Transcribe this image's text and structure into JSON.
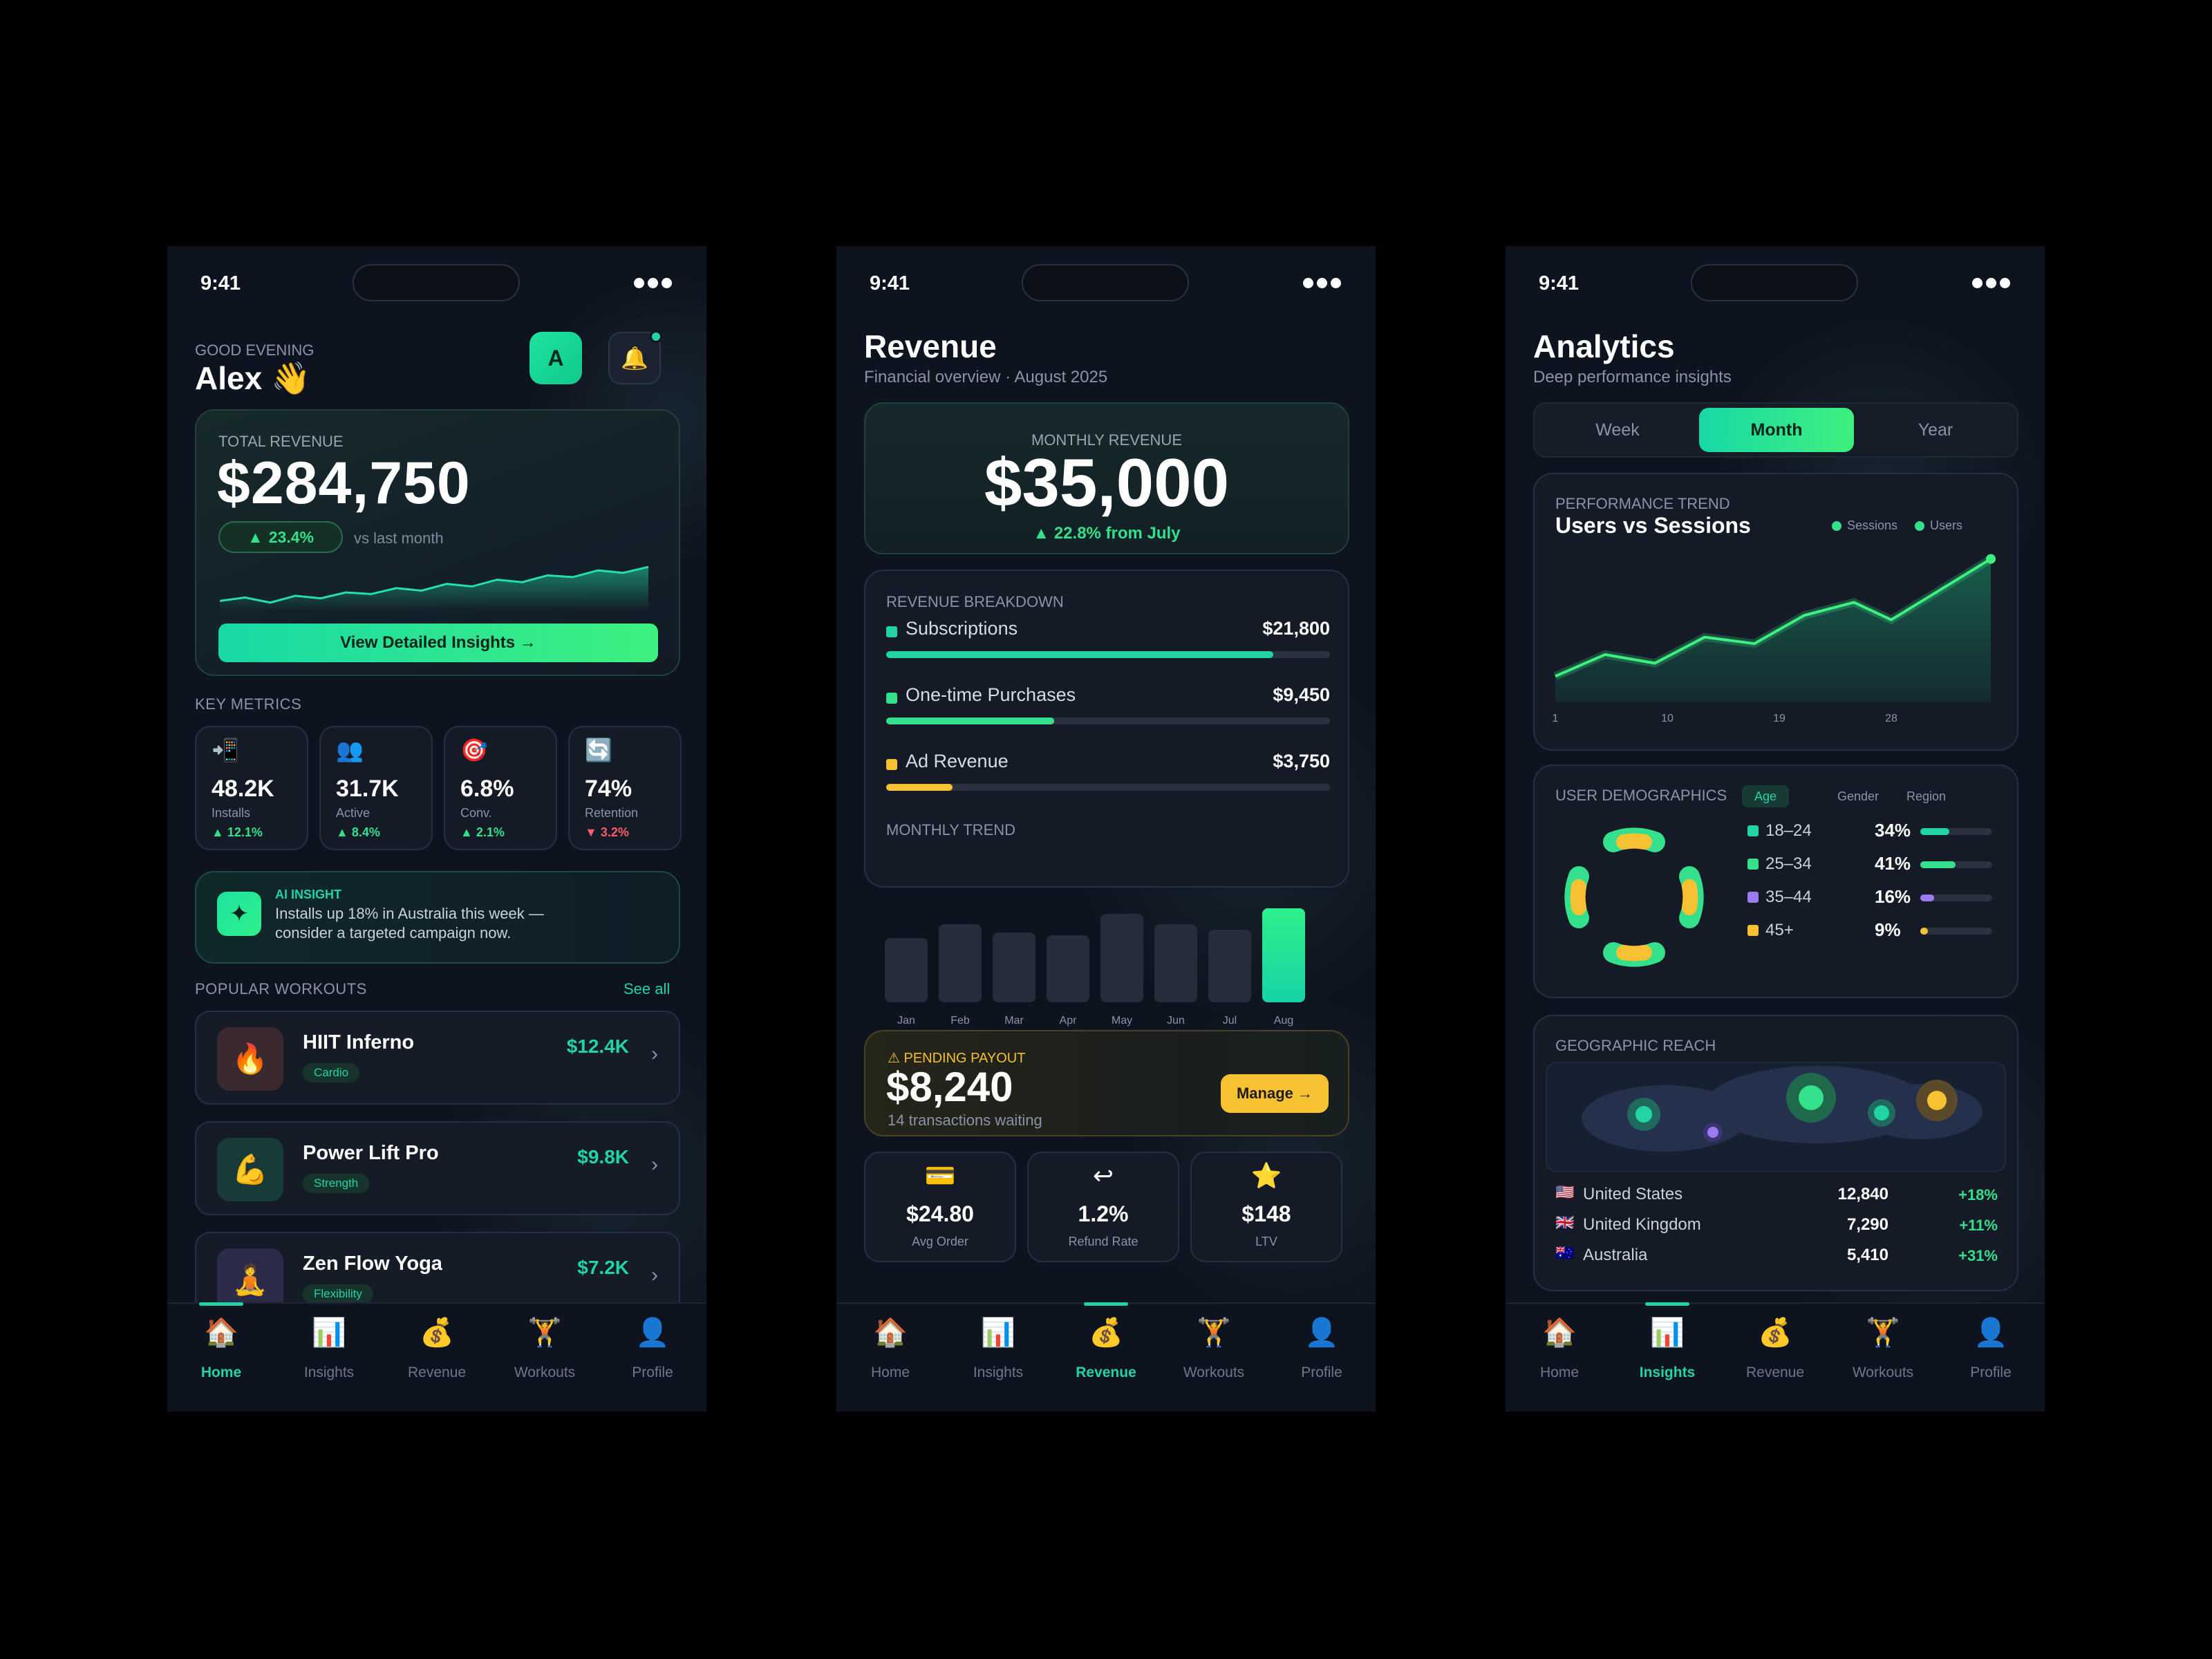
{
  "status": {
    "time": "9:41"
  },
  "colors": {
    "accent": "#22d3a6",
    "up": "#34e08b",
    "down": "#ff5c6a",
    "yellow": "#f6c233",
    "purple": "#9b7cf0"
  },
  "home": {
    "greeting": "GOOD EVENING",
    "name": "Alex 👋",
    "avatar": "A",
    "notification_icon": "bell-icon",
    "revenue": {
      "label": "TOTAL REVENUE",
      "value": "$284,750",
      "change": "23.4%",
      "compare": "vs last month",
      "button": "View Detailed Insights →",
      "sparkline": [
        30,
        34,
        28,
        36,
        33,
        40,
        38,
        45,
        42,
        50,
        47,
        55,
        52,
        60,
        58,
        66,
        63,
        70
      ]
    },
    "metrics_title": "KEY METRICS",
    "metrics": [
      {
        "icon": "📲",
        "value": "48.2K",
        "label": "Installs",
        "delta": "▲ 12.1%",
        "dir": "up"
      },
      {
        "icon": "👥",
        "value": "31.7K",
        "label": "Active",
        "delta": "▲ 8.4%",
        "dir": "up"
      },
      {
        "icon": "🎯",
        "value": "6.8%",
        "label": "Conv.",
        "delta": "▲ 2.1%",
        "dir": "up"
      },
      {
        "icon": "🔄",
        "value": "74%",
        "label": "Retention",
        "delta": "▼ 3.2%",
        "dir": "down"
      }
    ],
    "ai": {
      "icon": "✦",
      "title": "AI INSIGHT",
      "body": "Installs up 18% in Australia this week — consider a targeted campaign now."
    },
    "workouts_title": "POPULAR WORKOUTS",
    "see_all": "See all",
    "workouts": [
      {
        "icon": "🔥",
        "name": "HIIT Inferno",
        "tag": "Cardio",
        "price": "$12.4K",
        "bg": "#3a2a30"
      },
      {
        "icon": "💪",
        "name": "Power Lift Pro",
        "tag": "Strength",
        "price": "$9.8K",
        "bg": "#183a38"
      },
      {
        "icon": "🧘",
        "name": "Zen Flow Yoga",
        "tag": "Flexibility",
        "price": "$7.2K",
        "bg": "#2c2c4a"
      }
    ]
  },
  "tabs": [
    {
      "icon": "🏠",
      "label": "Home"
    },
    {
      "icon": "📊",
      "label": "Insights"
    },
    {
      "icon": "💰",
      "label": "Revenue"
    },
    {
      "icon": "🏋",
      "label": "Workouts"
    },
    {
      "icon": "👤",
      "label": "Profile"
    }
  ],
  "revenue": {
    "title": "Revenue",
    "subtitle": "Financial overview · August 2025",
    "monthly": {
      "label": "MONTHLY REVENUE",
      "value": "$35,000",
      "change": "▲ 22.8% from July"
    },
    "breakdown_title": "REVENUE BREAKDOWN",
    "breakdown": [
      {
        "name": "Subscriptions",
        "value": "$21,800",
        "amount": 21800,
        "color": "#22d3a6"
      },
      {
        "name": "One-time Purchases",
        "value": "$9,450",
        "amount": 9450,
        "color": "#34e08b"
      },
      {
        "name": "Ad Revenue",
        "value": "$3,750",
        "amount": 3750,
        "color": "#f6c233"
      }
    ],
    "trend_title": "MONTHLY TREND",
    "trend": {
      "months": [
        "Jan",
        "Feb",
        "Mar",
        "Apr",
        "May",
        "Jun",
        "Jul",
        "Aug"
      ],
      "values": [
        24,
        29,
        26,
        25,
        33,
        29,
        27,
        35
      ],
      "highlight": 7
    },
    "payout": {
      "label": "⚠ PENDING PAYOUT",
      "value": "$8,240",
      "sub": "14 transactions waiting",
      "button": "Manage →"
    },
    "stats": [
      {
        "icon": "💳",
        "value": "$24.80",
        "label": "Avg Order"
      },
      {
        "icon": "↩",
        "value": "1.2%",
        "label": "Refund Rate"
      },
      {
        "icon": "⭐",
        "value": "$148",
        "label": "LTV"
      }
    ]
  },
  "analytics": {
    "title": "Analytics",
    "subtitle": "Deep performance insights",
    "periods": [
      "Week",
      "Month",
      "Year"
    ],
    "active_period": 1,
    "performance": {
      "label": "PERFORMANCE TREND",
      "title": "Users vs Sessions",
      "legend": [
        "Sessions",
        "Users"
      ]
    },
    "demographics": {
      "label": "USER DEMOGRAPHICS",
      "tabs": [
        "Age",
        "Gender",
        "Region"
      ],
      "rows": [
        {
          "name": "18–24",
          "value": "34%",
          "pct": 34,
          "color": "#22d3a6"
        },
        {
          "name": "25–34",
          "value": "41%",
          "pct": 41,
          "color": "#34e08b"
        },
        {
          "name": "35–44",
          "value": "16%",
          "pct": 16,
          "color": "#9b7cf0"
        },
        {
          "name": "45+",
          "value": "9%",
          "pct": 9,
          "color": "#f6c233"
        }
      ]
    },
    "geo": {
      "label": "GEOGRAPHIC REACH",
      "rows": [
        {
          "flag": "🇺🇸",
          "country": "United States",
          "value": "12,840",
          "change": "+18%"
        },
        {
          "flag": "🇬🇧",
          "country": "United Kingdom",
          "value": "7,290",
          "change": "+11%"
        },
        {
          "flag": "🇦🇺",
          "country": "Australia",
          "value": "5,410",
          "change": "+31%"
        }
      ]
    }
  },
  "chart_data": [
    {
      "type": "line",
      "title": "Users vs Sessions",
      "x_ticks": [
        "1",
        "10",
        "19",
        "28"
      ],
      "x": [
        1,
        5,
        9,
        13,
        17,
        21,
        25,
        28,
        32,
        36
      ],
      "series": [
        {
          "name": "Sessions",
          "values": [
            12,
            22,
            18,
            30,
            27,
            40,
            46,
            38,
            52,
            66
          ]
        }
      ],
      "ylim": [
        0,
        70
      ],
      "grid": false,
      "legend": "top-right"
    },
    {
      "type": "bar",
      "title": "MONTHLY TREND",
      "categories": [
        "Jan",
        "Feb",
        "Mar",
        "Apr",
        "May",
        "Jun",
        "Jul",
        "Aug"
      ],
      "values": [
        24,
        29,
        26,
        25,
        33,
        29,
        27,
        35
      ]
    }
  ]
}
